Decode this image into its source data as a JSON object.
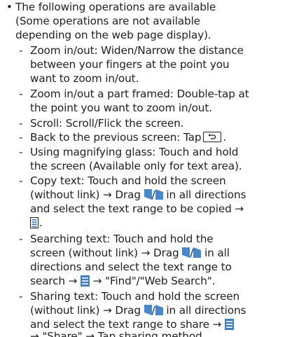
{
  "bullet_symbol": "•",
  "intro": [
    "The following operations are available",
    "(Some operations are not available",
    "depending on the web page display)."
  ],
  "items": [
    {
      "lines": [
        "Zoom in/out: Widen/Narrow the distance",
        "between your fingers at the point you",
        "want to zoom in/out."
      ]
    },
    {
      "lines": [
        "Zoom in/out a part framed: Double-tap at",
        "the point you want to zoom in/out."
      ]
    },
    {
      "lines": [
        "Scroll: Scroll/Flick the screen."
      ]
    },
    {
      "line_before_icon": "Back to the previous screen: Tap",
      "line_after_icon": "."
    },
    {
      "lines": [
        "Using magnifying glass: Touch and hold",
        "the screen (Available only for text area)."
      ]
    },
    {
      "copy_l1": "Copy text: Touch and hold the screen",
      "copy_l2_a": "(without link) → Drag",
      "copy_l2_b": "in all directions",
      "copy_l3": "and select the text range to be copied →",
      "copy_l4": "."
    },
    {
      "search_l1": "Searching text: Touch and hold the",
      "search_l2_a": "screen (without link) → Drag",
      "search_l2_b": "in all",
      "search_l3": "directions and select the text range to",
      "search_l4_a": "search →",
      "search_l4_b": "→ \"Find\"/\"Web Search\"."
    },
    {
      "share_l1": "Sharing text: Touch and hold the screen",
      "share_l2_a": "(without link) → Drag",
      "share_l2_b": "in all directions",
      "share_l3_a": "and select the text range to share →",
      "share_l4": "→ \"Share\" → Tap sharing method."
    }
  ],
  "icons": {
    "back": "back-key-icon",
    "handles_separator": "/",
    "menu": "menu-icon",
    "handle_color": "#4a86c8",
    "menu_color": "#3f7fbf"
  }
}
